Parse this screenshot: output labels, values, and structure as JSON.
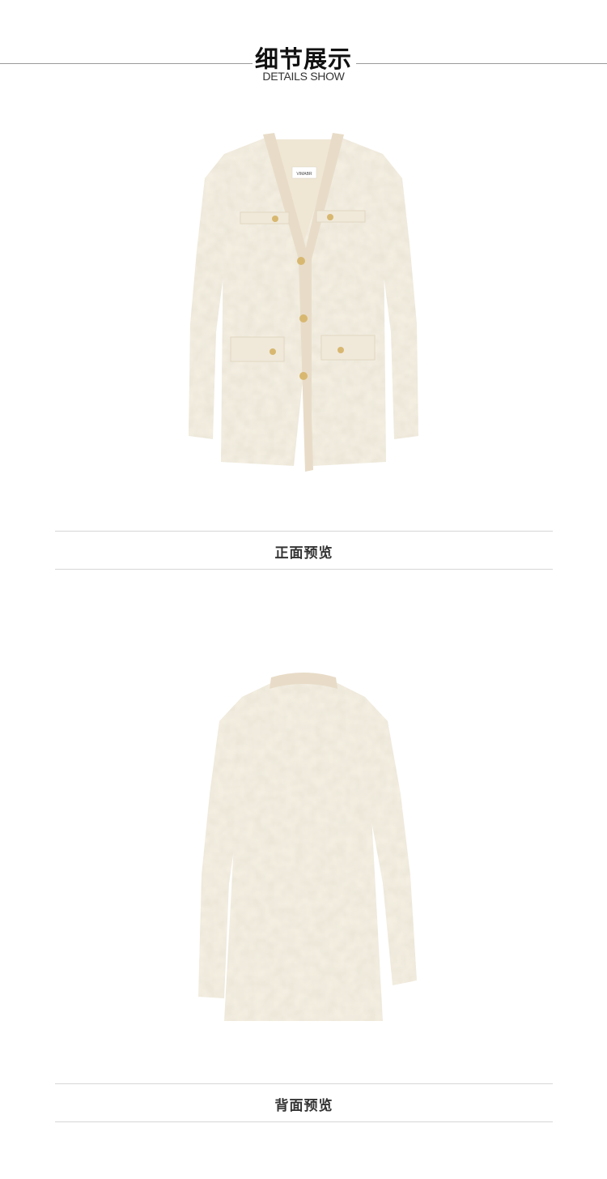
{
  "header": {
    "title_cn": "细节展示",
    "title_en": "DETAILS SHOW"
  },
  "front": {
    "caption": "正面预览",
    "brand_label": "VIMABR"
  },
  "back": {
    "caption": "背面预览"
  },
  "colors": {
    "fabric": "#f6f1e4",
    "trim": "#e8dcc8",
    "button": "#d8b870"
  }
}
